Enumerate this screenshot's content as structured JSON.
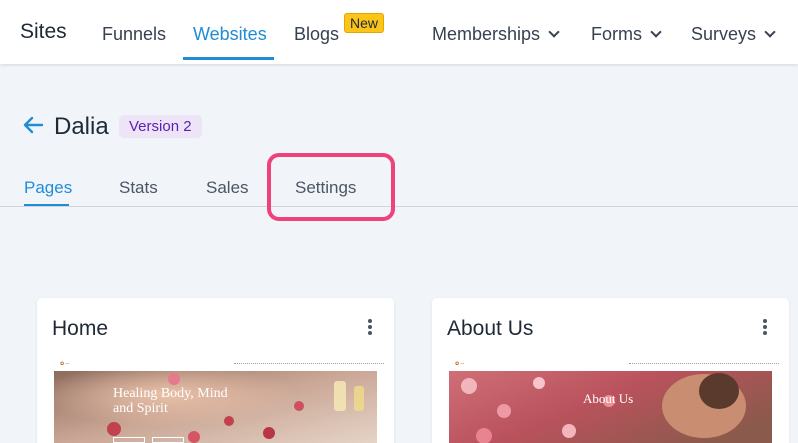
{
  "nav": {
    "brand": "Sites",
    "items": [
      {
        "label": "Funnels"
      },
      {
        "label": "Websites"
      },
      {
        "label": "Blogs"
      },
      {
        "label": "Memberships"
      },
      {
        "label": "Forms"
      },
      {
        "label": "Surveys"
      }
    ],
    "new_badge": "New"
  },
  "header": {
    "title": "Dalia",
    "version": "Version 2"
  },
  "tabs": [
    {
      "label": "Pages"
    },
    {
      "label": "Stats"
    },
    {
      "label": "Sales"
    },
    {
      "label": "Settings"
    }
  ],
  "cards": [
    {
      "title": "Home",
      "hero_text": "Healing Body, Mind and Spirit"
    },
    {
      "title": "About Us",
      "hero_text": "About Us"
    }
  ],
  "colors": {
    "accent": "#1f8dd6",
    "highlight": "#f0427a",
    "new_badge": "#fcc419",
    "version_badge_bg": "#ede4f7",
    "version_badge_text": "#5b21b6"
  }
}
